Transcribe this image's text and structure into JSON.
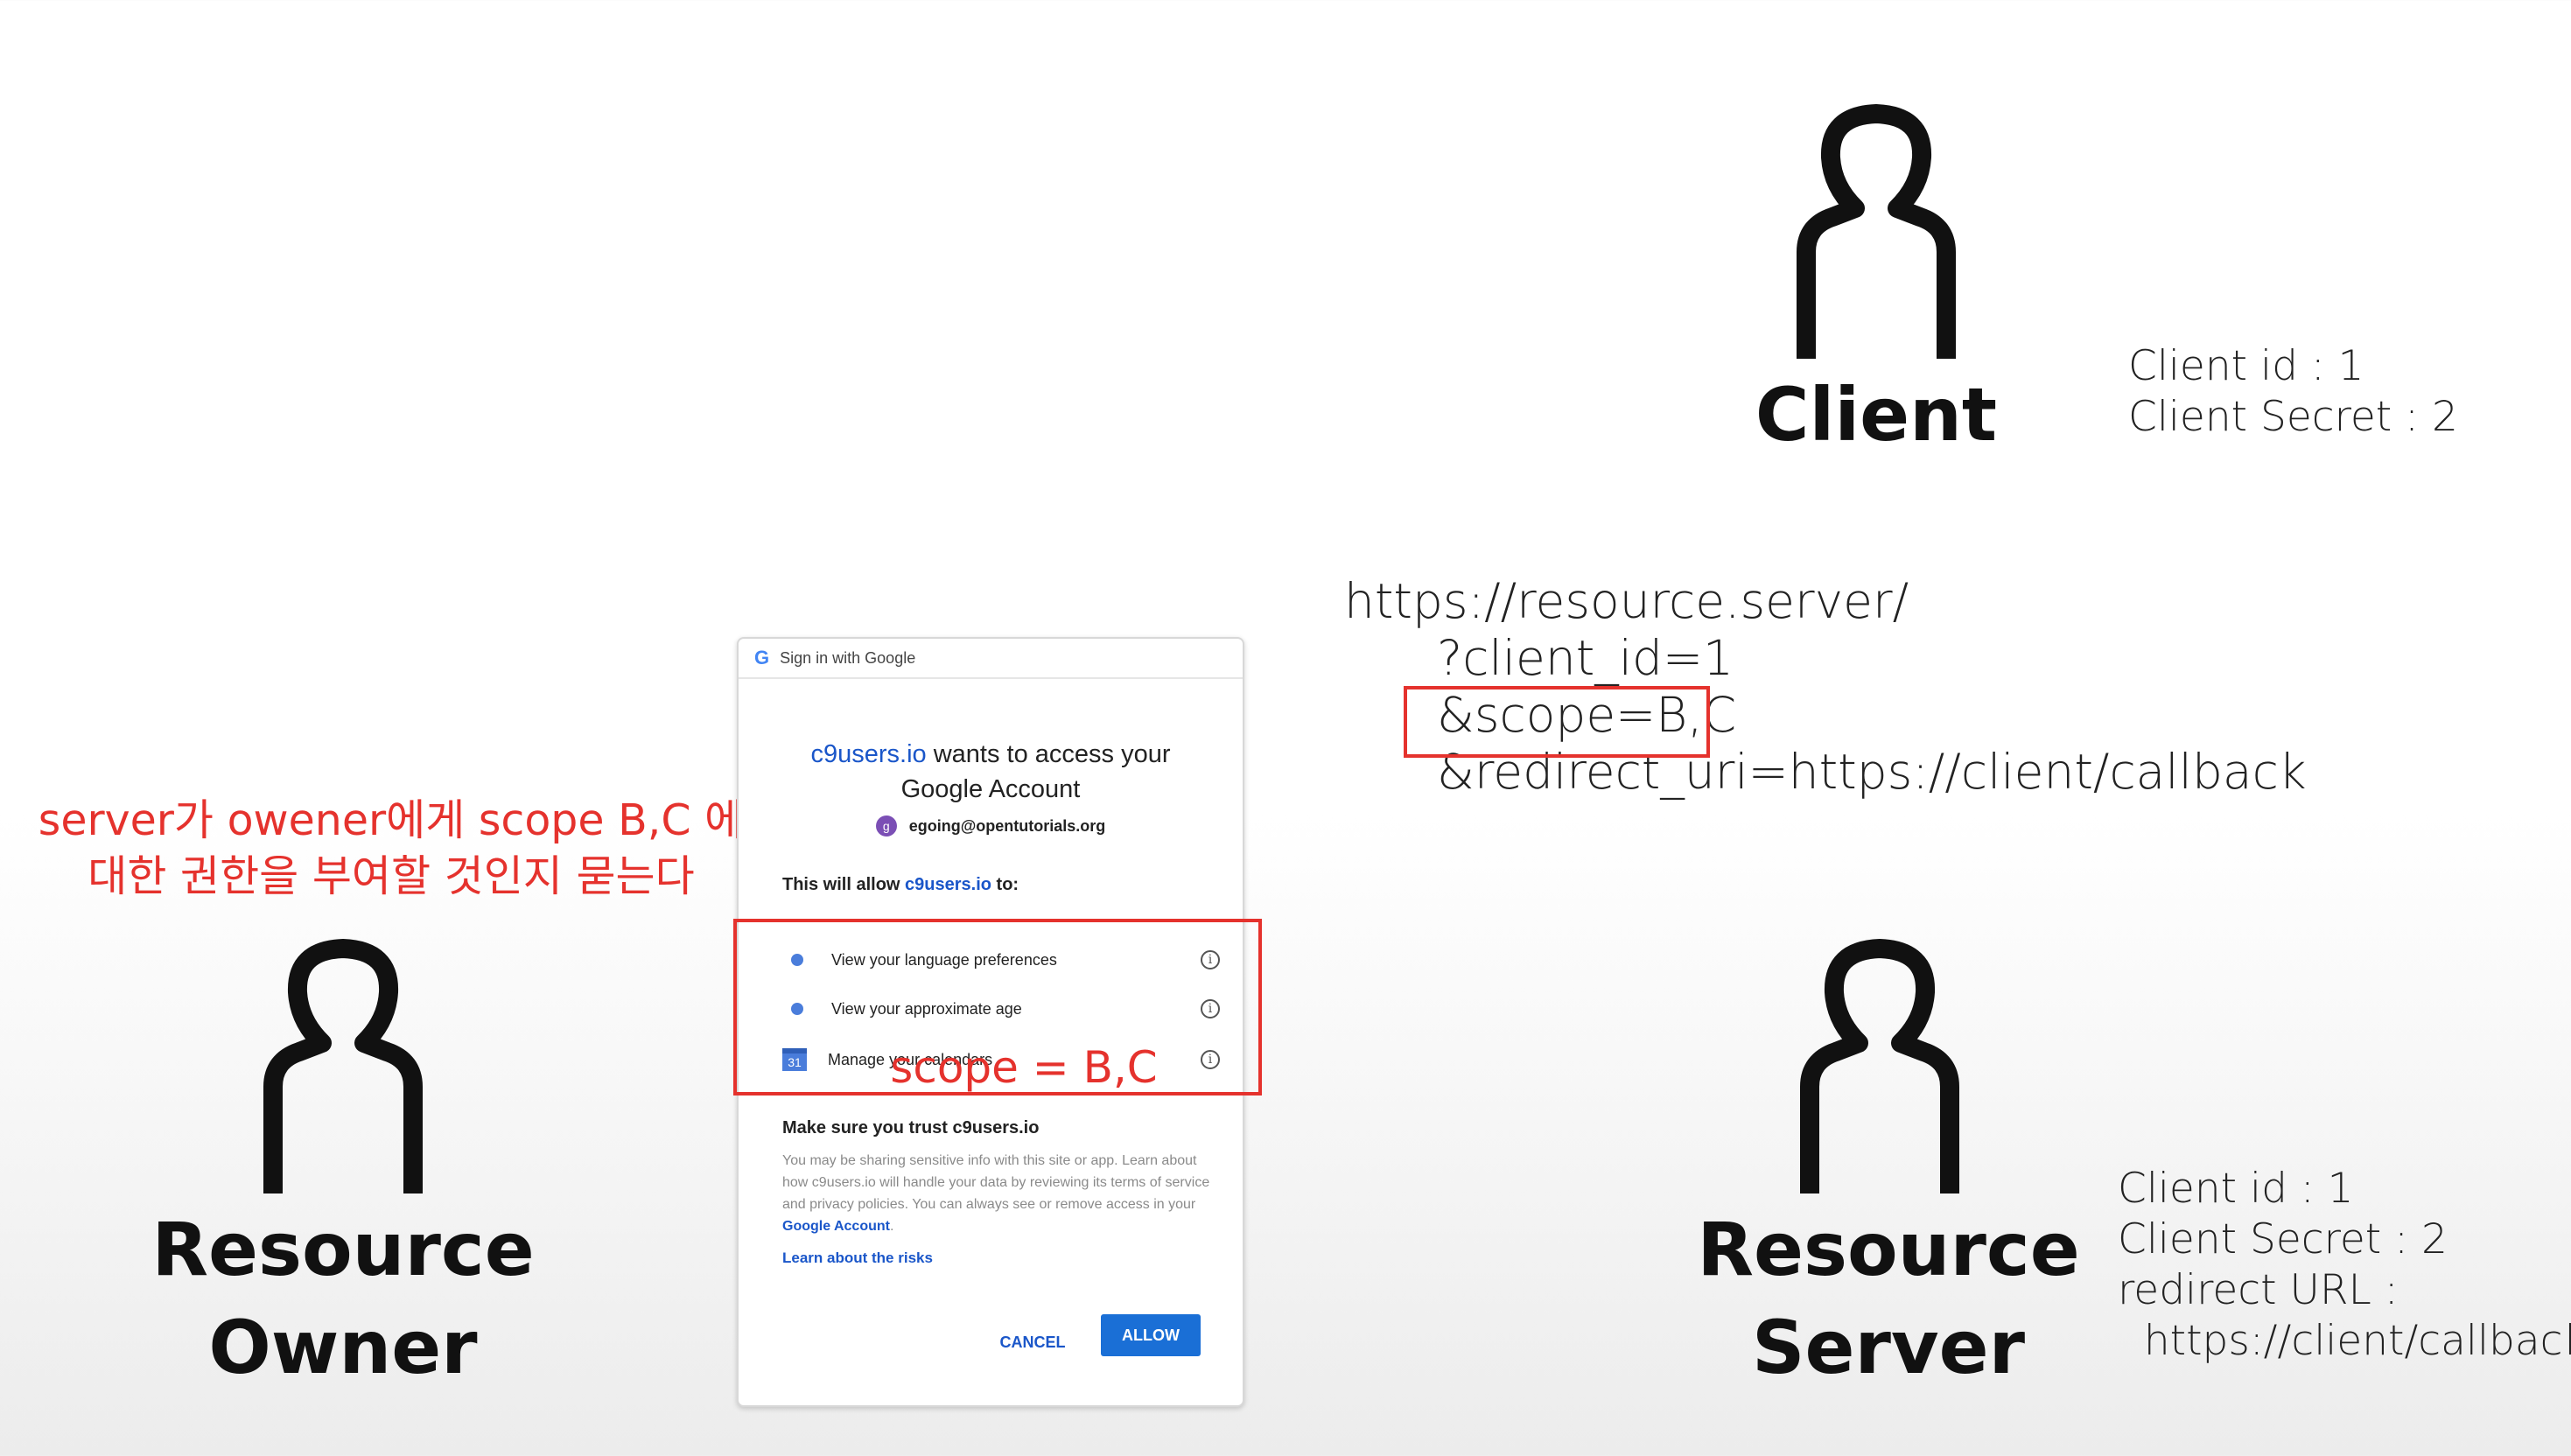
{
  "client": {
    "label": "Client",
    "info_lines": "Client id : 1\nClient Secret : 2"
  },
  "resource_owner": {
    "label": "Resource\nOwner"
  },
  "resource_server": {
    "label": "Resource\nServer",
    "info_lines": "Client id : 1\nClient Secret : 2\nredirect URL :\n  https://client/callback"
  },
  "request_url": {
    "line1": "https://resource.server/",
    "line2": "?client_id=1",
    "line3": "&scope=B,C",
    "line4": "&redirect_uri=https://client/callback"
  },
  "annotation": {
    "text": "server가 owener에게 scope B,C 에\n대한 권한을 부여할 것인지 묻는다",
    "scope_label": "scope = B,C"
  },
  "dialog": {
    "header_logo": "G",
    "header_text": "Sign in with Google",
    "app_name": "c9users.io",
    "title_rest": " wants to access your",
    "title_line2": "Google Account",
    "avatar_letter": "g",
    "account_email": "egoing@opentutorials.org",
    "allow_prefix": "This will allow ",
    "allow_app": "c9users.io",
    "allow_suffix": " to:",
    "permissions": [
      {
        "label": "View your language preferences"
      },
      {
        "label": "View your approximate age"
      },
      {
        "label": "Manage your calendars",
        "icon_text": "31"
      }
    ],
    "info_glyph": "i",
    "trust_title": "Make sure you trust c9users.io",
    "trust_body": "You may be sharing sensitive info with this site or app. Learn about how c9users.io will handle your data by reviewing its terms of service and privacy policies. You can always see or remove access in your ",
    "trust_link": "Google Account",
    "trust_end": ".",
    "risks_link": "Learn about the risks",
    "cancel_label": "CANCEL",
    "allow_label": "ALLOW"
  },
  "colors": {
    "annotation_red": "#e5322d",
    "link_blue": "#1a56c9",
    "allow_button": "#1a6fd6"
  }
}
